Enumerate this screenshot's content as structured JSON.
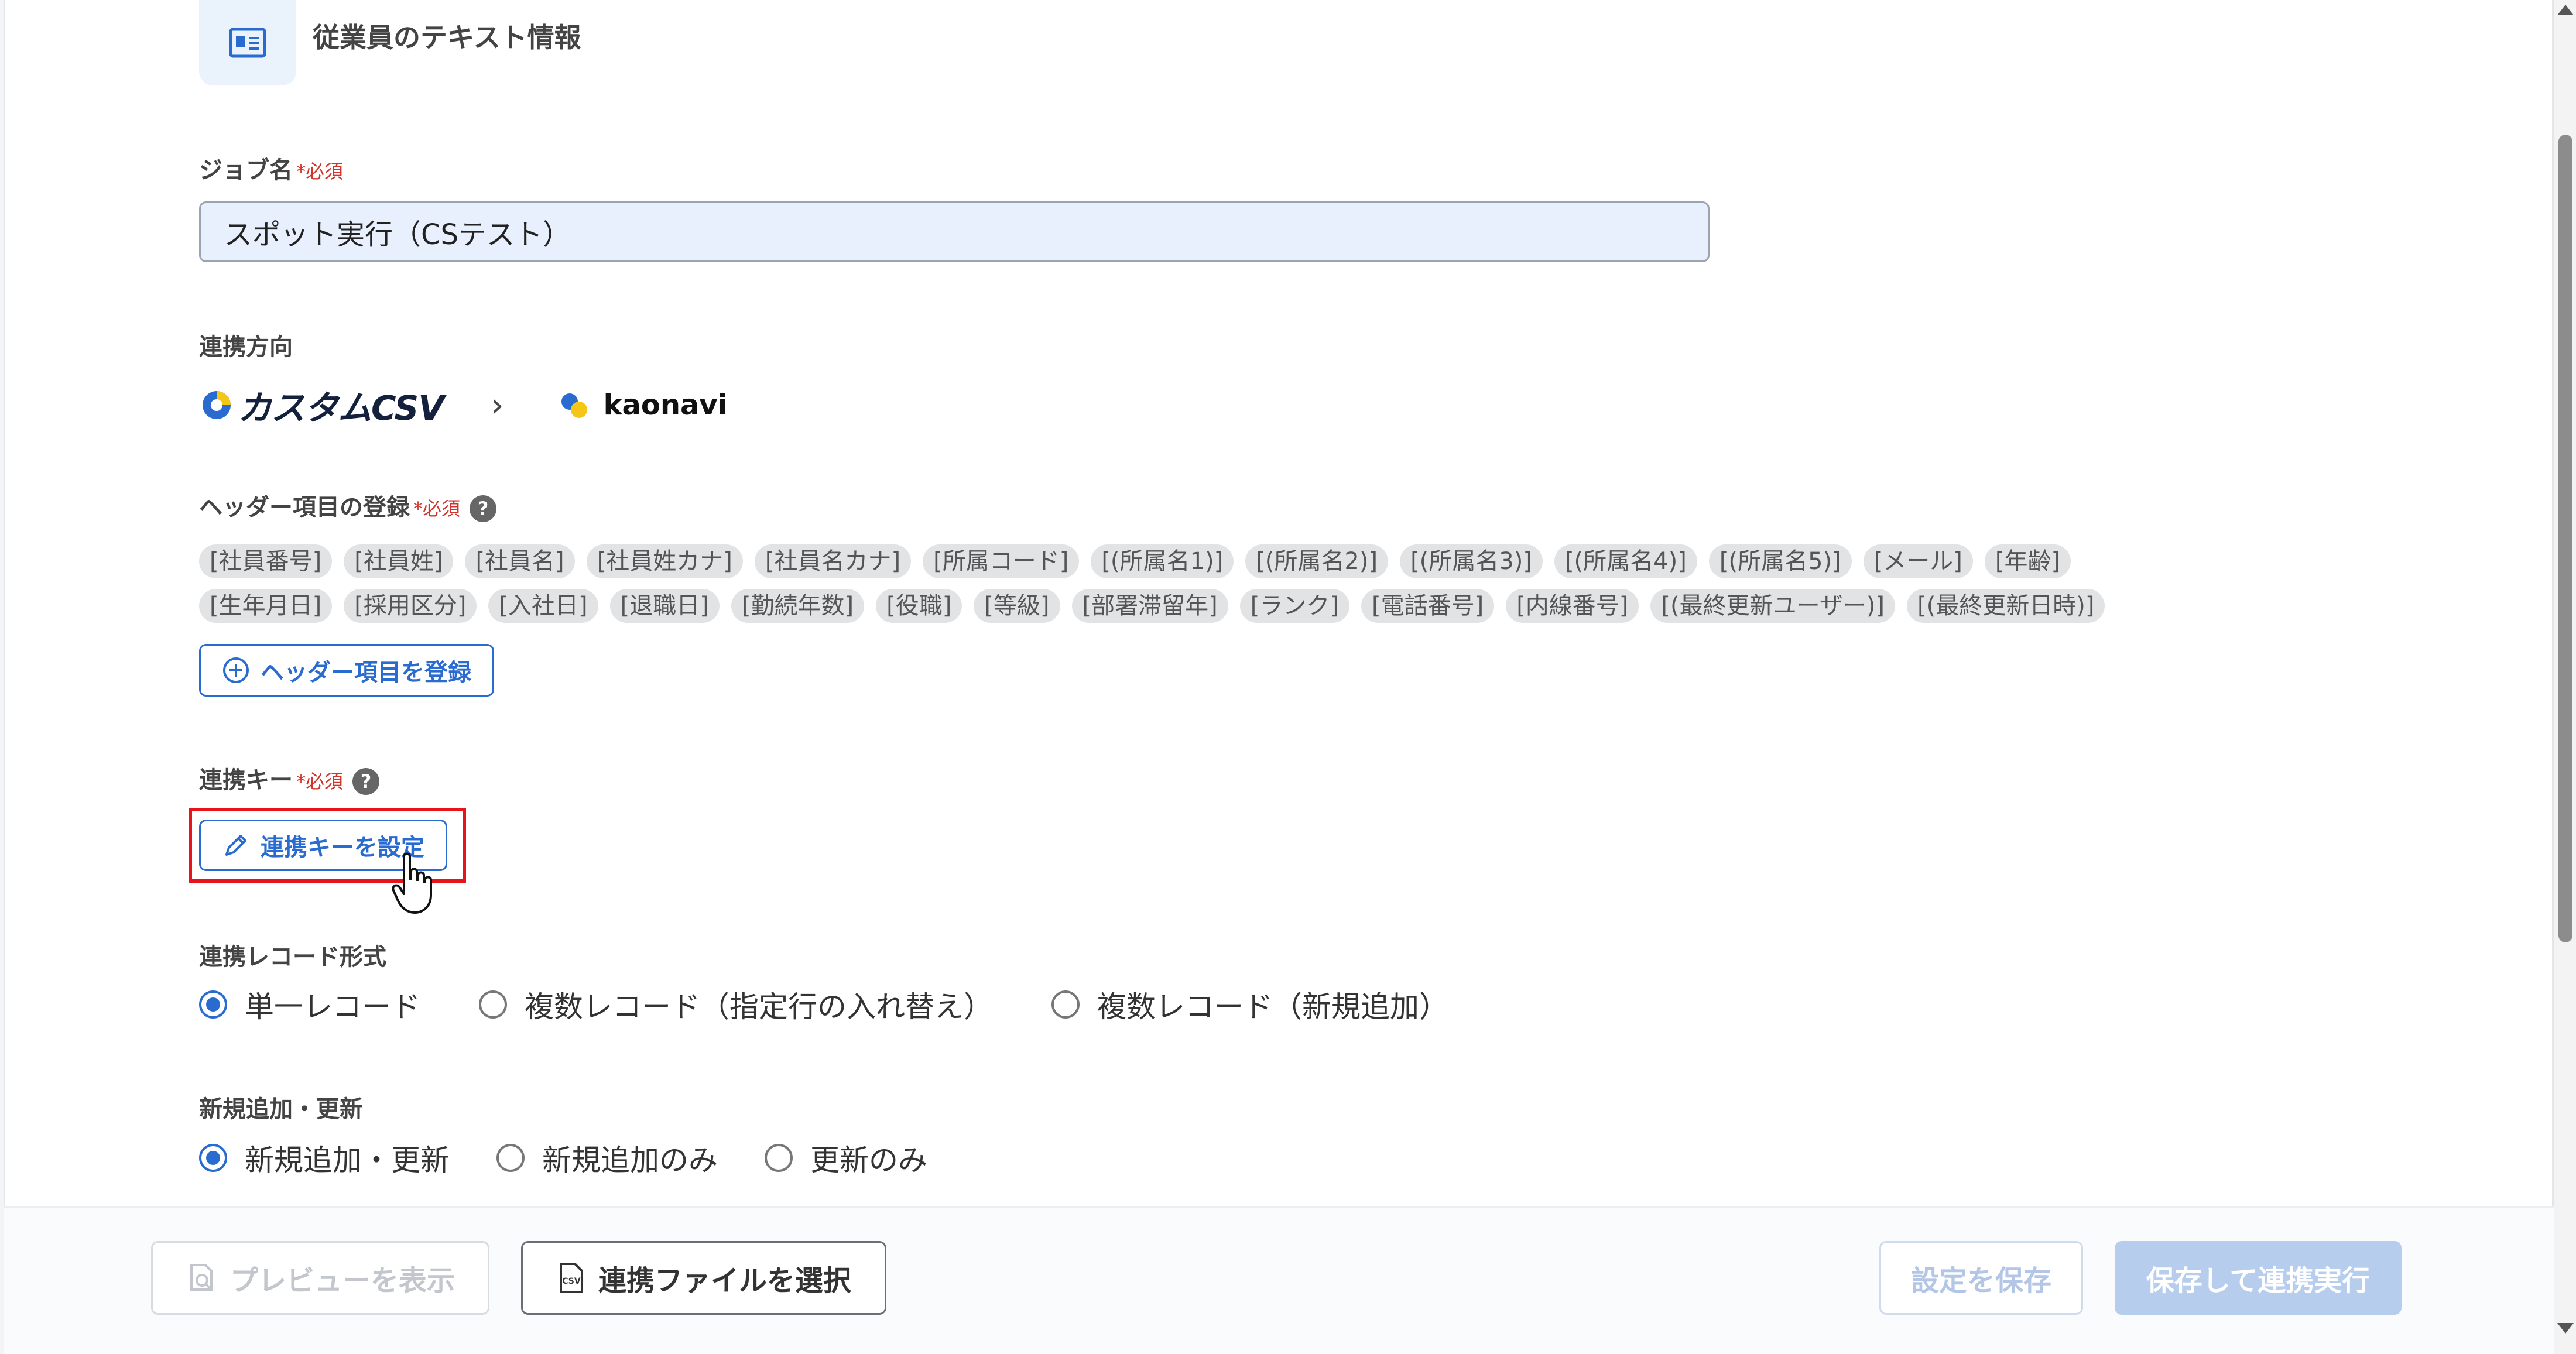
{
  "section": {
    "icon": "id-card-icon",
    "title": "従業員のテキスト情報"
  },
  "job_name": {
    "label": "ジョブ名",
    "required": "*必須",
    "value": "スポット実行（CSテスト）"
  },
  "direction": {
    "label": "連携方向",
    "source": "カスタムCSV",
    "target": "kaonavi"
  },
  "header_items": {
    "label": "ヘッダー項目の登録",
    "required": "*必須",
    "help": "?",
    "row1": [
      "[社員番号]",
      "[社員姓]",
      "[社員名]",
      "[社員姓カナ]",
      "[社員名カナ]",
      "[所属コード]",
      "[(所属名1)]",
      "[(所属名2)]",
      "[(所属名3)]",
      "[(所属名4)]",
      "[(所属名5)]",
      "[メール]",
      "[年齢]"
    ],
    "row2": [
      "[生年月日]",
      "[採用区分]",
      "[入社日]",
      "[退職日]",
      "[勤続年数]",
      "[役職]",
      "[等級]",
      "[部署滞留年]",
      "[ランク]",
      "[電話番号]",
      "[内線番号]",
      "[(最終更新ユーザー)]",
      "[(最終更新日時)]"
    ],
    "register_button": "ヘッダー項目を登録"
  },
  "link_key": {
    "label": "連携キー",
    "required": "*必須",
    "help": "?",
    "set_button": "連携キーを設定"
  },
  "record_format": {
    "label": "連携レコード形式",
    "options": [
      "単一レコード",
      "複数レコード（指定行の入れ替え）",
      "複数レコード（新規追加）"
    ],
    "selected": "単一レコード"
  },
  "add_update": {
    "label": "新規追加・更新",
    "options": [
      "新規追加・更新",
      "新規追加のみ",
      "更新のみ"
    ],
    "selected": "新規追加・更新"
  },
  "footer": {
    "preview": "プレビューを表示",
    "select_file": "連携ファイルを選択",
    "save_settings": "設定を保存",
    "save_and_run": "保存して連携実行"
  },
  "colors": {
    "accent": "#2a6bd0",
    "required": "#d0342c",
    "highlight": "#e8141b",
    "disabled_primary": "#b7cdee"
  }
}
